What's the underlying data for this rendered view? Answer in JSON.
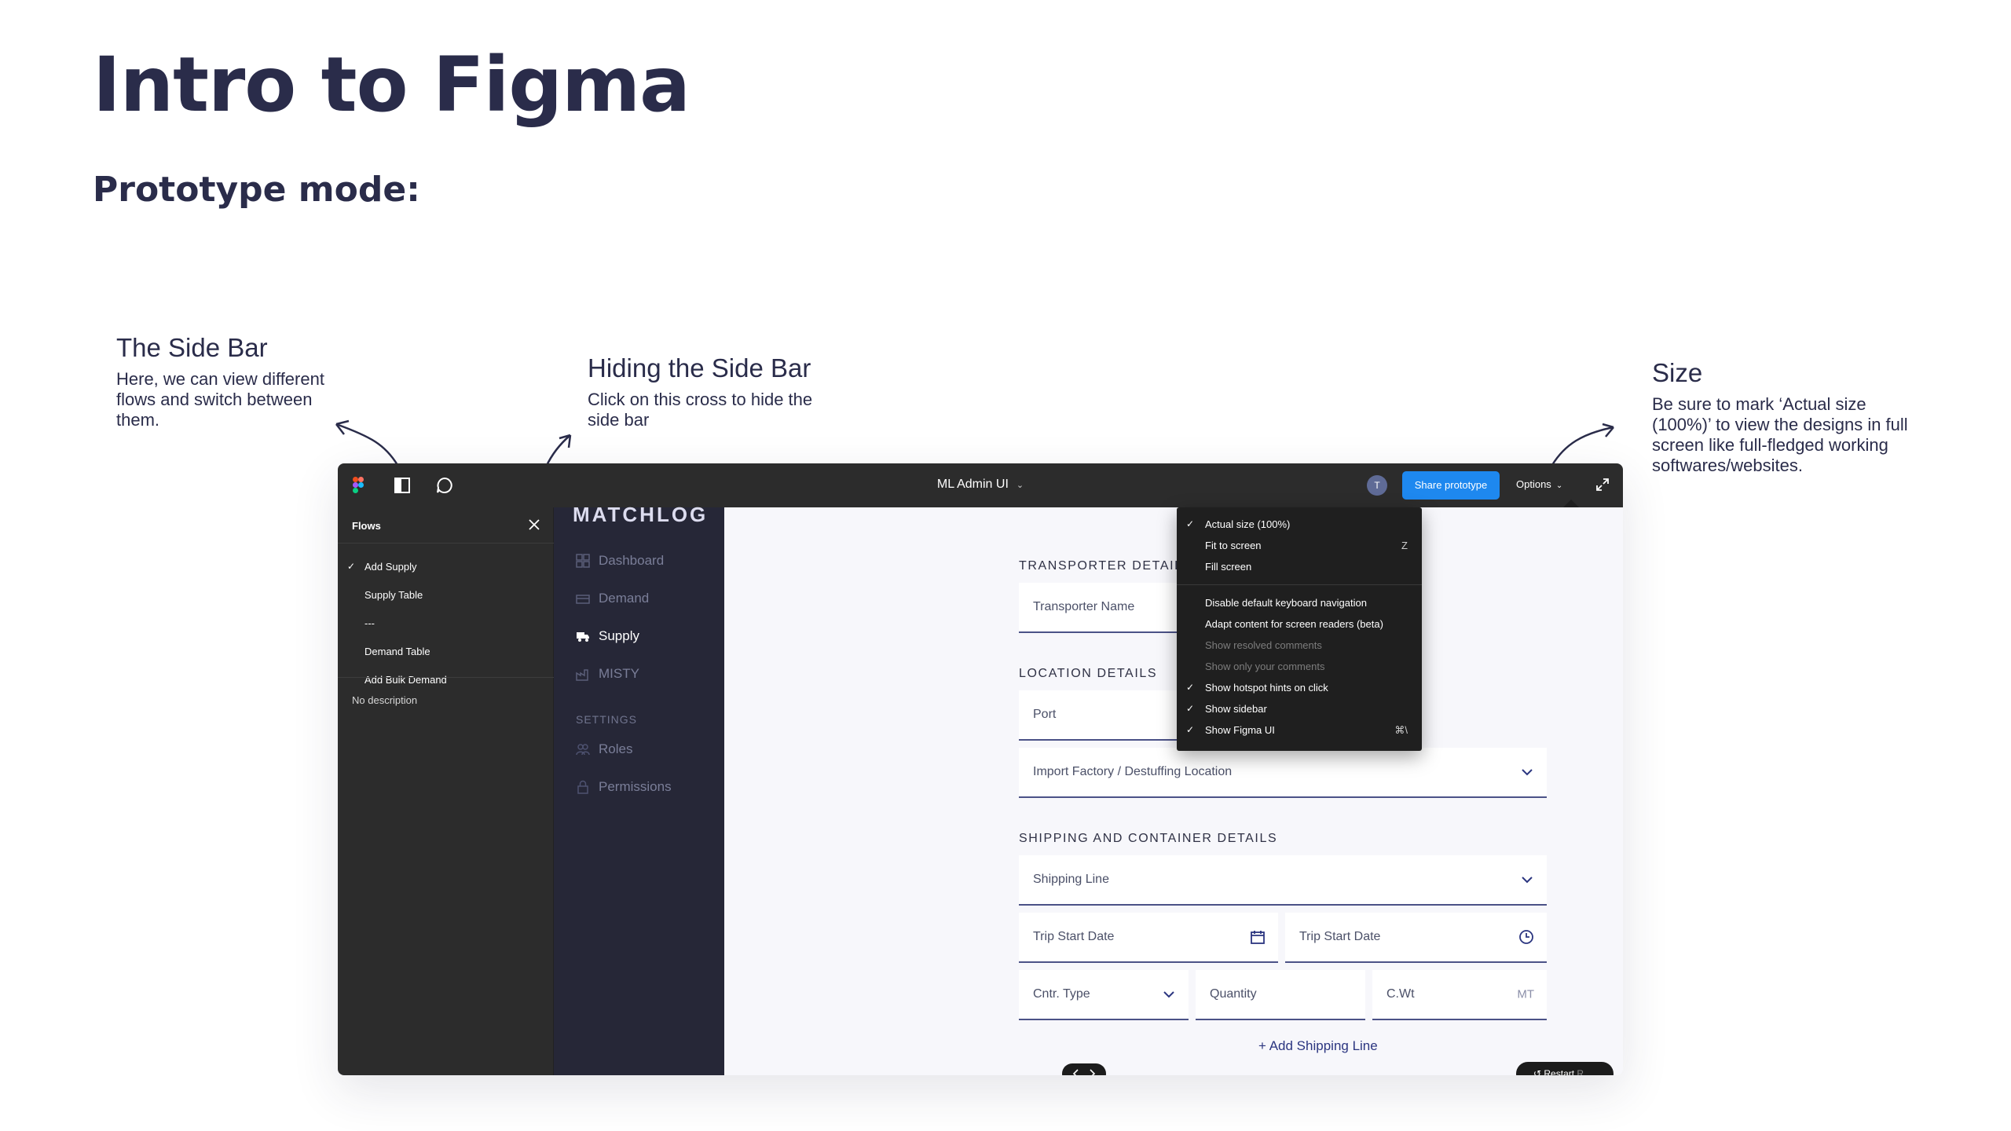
{
  "slide": {
    "title": "Intro to Figma",
    "subtitle": "Prototype mode:"
  },
  "annotations": {
    "sidebar": {
      "heading": "The Side Bar",
      "text": "Here, we can view different flows and switch between them."
    },
    "hide": {
      "heading": "Hiding the Side Bar",
      "text": "Click on this cross to hide the side bar"
    },
    "size": {
      "heading": "Size",
      "text": "Be sure to mark ‘Actual size (100%)’ to view the designs in full screen like full-fledged working softwares/websites."
    }
  },
  "figma": {
    "file_title": "ML Admin UI",
    "avatar_initial": "T",
    "share_label": "Share prototype",
    "options_label": "Options",
    "flows": {
      "header": "Flows",
      "items": [
        {
          "label": "Add Supply",
          "checked": true
        },
        {
          "label": "Supply Table",
          "checked": false
        },
        {
          "label": "---",
          "checked": false
        },
        {
          "label": "Demand Table",
          "checked": false
        },
        {
          "label": "Add Bulk Demand",
          "checked": false
        }
      ],
      "description": "No description"
    },
    "options_menu": {
      "items": [
        {
          "label": "Actual size (100%)",
          "checked": true,
          "shortcut": "",
          "dim": false
        },
        {
          "label": "Fit to screen",
          "checked": false,
          "shortcut": "Z",
          "dim": false
        },
        {
          "label": "Fill screen",
          "checked": false,
          "shortcut": "",
          "dim": false
        },
        {
          "label": "Disable default keyboard navigation",
          "checked": false,
          "shortcut": "",
          "dim": false
        },
        {
          "label": "Adapt content for screen readers (beta)",
          "checked": false,
          "shortcut": "",
          "dim": false
        },
        {
          "label": "Show resolved comments",
          "checked": false,
          "shortcut": "",
          "dim": true
        },
        {
          "label": "Show only your comments",
          "checked": false,
          "shortcut": "",
          "dim": true
        },
        {
          "label": "Show hotspot hints on click",
          "checked": true,
          "shortcut": "",
          "dim": false
        },
        {
          "label": "Show sidebar",
          "checked": true,
          "shortcut": "",
          "dim": false
        },
        {
          "label": "Show Figma UI",
          "checked": true,
          "shortcut": "⌘\\",
          "dim": false
        }
      ]
    },
    "restart_label": "Restart",
    "restart_shortcut": "R"
  },
  "app": {
    "logo": "MATCHLOG",
    "nav": [
      {
        "label": "Dashboard",
        "active": false
      },
      {
        "label": "Demand",
        "active": false
      },
      {
        "label": "Supply",
        "active": true
      },
      {
        "label": "MISTY",
        "active": false
      }
    ],
    "settings_label": "SETTINGS",
    "settings_nav": [
      {
        "label": "Roles"
      },
      {
        "label": "Permissions"
      }
    ],
    "form": {
      "transporter_label": "TRANSPORTER DETAILS",
      "transporter_name": "Transporter Name",
      "location_label": "LOCATION DETAILS",
      "port": "Port",
      "factory": "Import Factory / Destuffing Location",
      "shipping_label": "SHIPPING AND CONTAINER DETAILS",
      "shipping_line": "Shipping Line",
      "trip_start_date_1": "Trip Start Date",
      "trip_start_date_2": "Trip Start Date",
      "cntr_type": "Cntr. Type",
      "quantity": "Quantity",
      "cwt": "C.Wt",
      "cwt_unit": "MT",
      "add_shipping_line": "+ Add Shipping Line"
    }
  },
  "colors": {
    "accent": "#1e88ef",
    "dark_text": "#2a2c4a",
    "nav_bg": "#262737",
    "figma_chrome": "#2c2c2c"
  }
}
